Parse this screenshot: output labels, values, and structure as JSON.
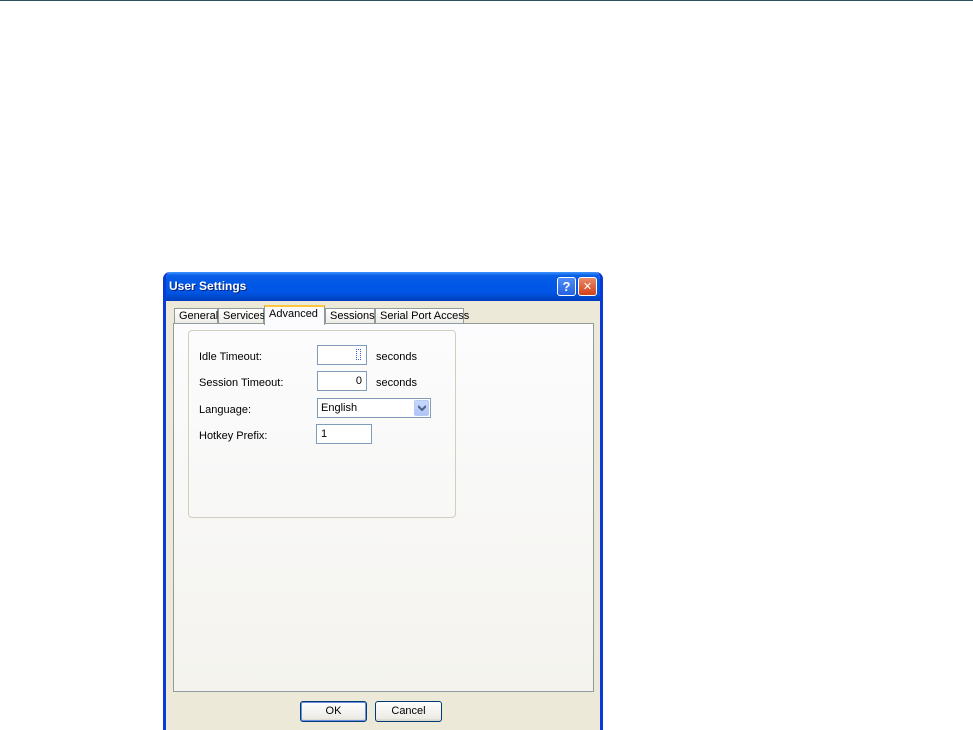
{
  "window": {
    "title": "User Settings",
    "help_label": "?",
    "close_label": "✕"
  },
  "tabs": [
    {
      "label": "General",
      "active": false
    },
    {
      "label": "Services",
      "active": false
    },
    {
      "label": "Advanced",
      "active": true
    },
    {
      "label": "Sessions",
      "active": false
    },
    {
      "label": "Serial Port Access",
      "active": false
    }
  ],
  "fields": {
    "idle_timeout": {
      "label": "Idle Timeout:",
      "value": "0",
      "unit": "seconds"
    },
    "session_timeout": {
      "label": "Session Timeout:",
      "value": "0",
      "unit": "seconds"
    },
    "language": {
      "label": "Language:",
      "value": "English"
    },
    "hotkey_prefix": {
      "label": "Hotkey Prefix:",
      "value": "1"
    }
  },
  "buttons": {
    "ok": "OK",
    "cancel": "Cancel"
  },
  "colors": {
    "titlebar": "#0055e5",
    "window_frame": "#0a3ad6",
    "dialog_bg": "#ece9d8",
    "active_tab_highlight": "#ffc83c"
  }
}
